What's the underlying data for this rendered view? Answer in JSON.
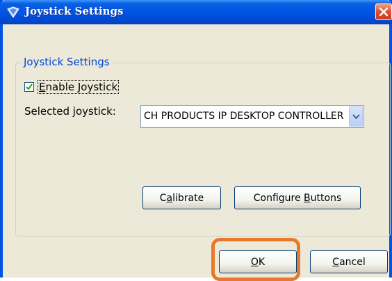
{
  "window": {
    "title": "Joystick Settings"
  },
  "group": {
    "legend": "Joystick Settings",
    "enable": {
      "pre": "",
      "key": "E",
      "post": "nable Joystick",
      "checked": true
    },
    "selected_label": "Selected joystick:",
    "selected_value": "CH PRODUCTS IP DESKTOP CONTROLLER"
  },
  "buttons": {
    "calibrate": {
      "pre": "C",
      "key": "a",
      "post": "librate"
    },
    "configure": {
      "pre": "Configure ",
      "key": "B",
      "post": "uttons"
    },
    "ok": {
      "pre": "",
      "key": "O",
      "post": "K"
    },
    "cancel": {
      "pre": "",
      "key": "C",
      "post": "ancel"
    }
  },
  "icons": {
    "title": "joystick-shield-icon",
    "close": "close-icon",
    "check": "checkmark-icon",
    "dropdown": "chevron-down-icon"
  },
  "colors": {
    "titlebar": "#0055e5",
    "legend": "#0046d5",
    "close": "#e0502e",
    "highlight": "#e8782a"
  }
}
